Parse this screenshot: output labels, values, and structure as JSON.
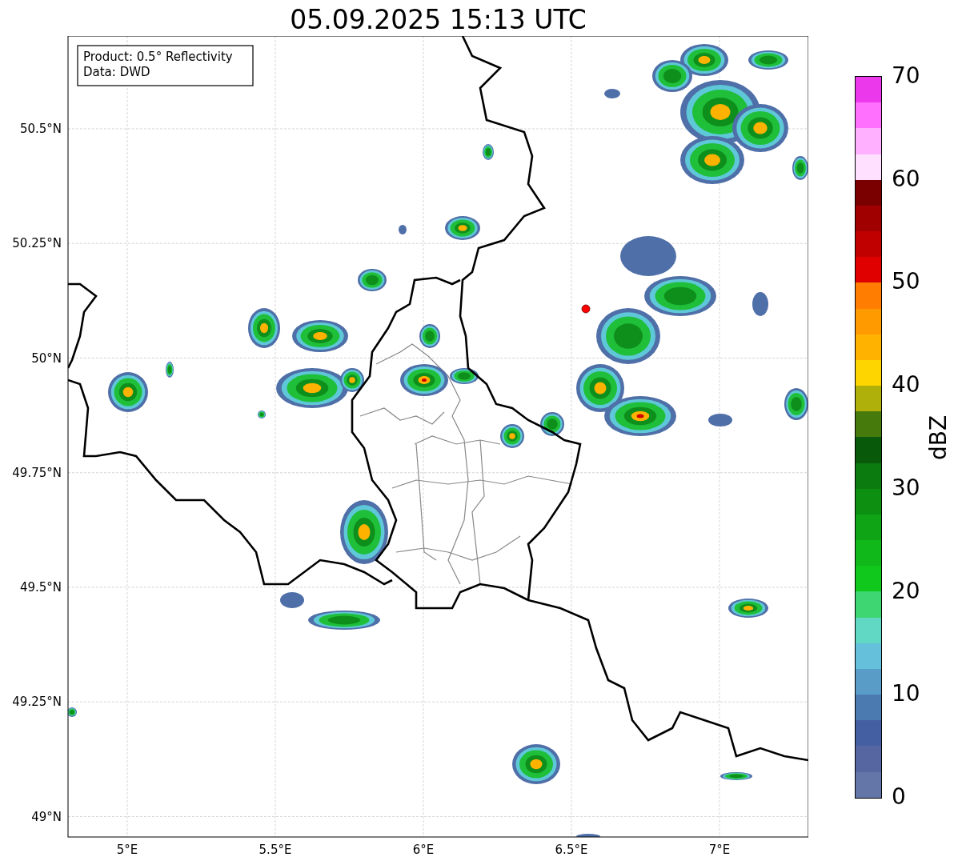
{
  "title": "05.09.2025 15:13 UTC",
  "info_box": {
    "lines": [
      "Product: 0.5° Reflectivity",
      "Data: DWD"
    ]
  },
  "lat_ticks": [
    "50.5°N",
    "50.25°N",
    "50°N",
    "49.75°N",
    "49.5°N",
    "49.25°N",
    "49°N"
  ],
  "lon_ticks": [
    "5°E",
    "5.5°E",
    "6°E",
    "6.5°E",
    "7°E"
  ],
  "colorbar": {
    "label": "dBZ",
    "ticks": [
      "70",
      "60",
      "50",
      "40",
      "30",
      "20",
      "10",
      "0"
    ],
    "segments": [
      {
        "color": "#ea38ea"
      },
      {
        "color": "#ff70ff"
      },
      {
        "color": "#ffb0ff"
      },
      {
        "color": "#ffe0ff"
      },
      {
        "color": "#7a0000"
      },
      {
        "color": "#a00000"
      },
      {
        "color": "#c00000"
      },
      {
        "color": "#e00000"
      },
      {
        "color": "#ff7d00"
      },
      {
        "color": "#ff9a00"
      },
      {
        "color": "#ffb300"
      },
      {
        "color": "#ffd500"
      },
      {
        "color": "#afb00a"
      },
      {
        "color": "#477a0c"
      },
      {
        "color": "#085a0a"
      },
      {
        "color": "#0b7a0f"
      },
      {
        "color": "#0d8f12"
      },
      {
        "color": "#0fa415"
      },
      {
        "color": "#10b81a"
      },
      {
        "color": "#10c81c"
      },
      {
        "color": "#3dd672"
      },
      {
        "color": "#60d8c4"
      },
      {
        "color": "#65c0dc"
      },
      {
        "color": "#5a9cc8"
      },
      {
        "color": "#4a7ab0"
      },
      {
        "color": "#4560a2"
      },
      {
        "color": "#5566a0"
      },
      {
        "color": "#6476a8"
      }
    ]
  }
}
